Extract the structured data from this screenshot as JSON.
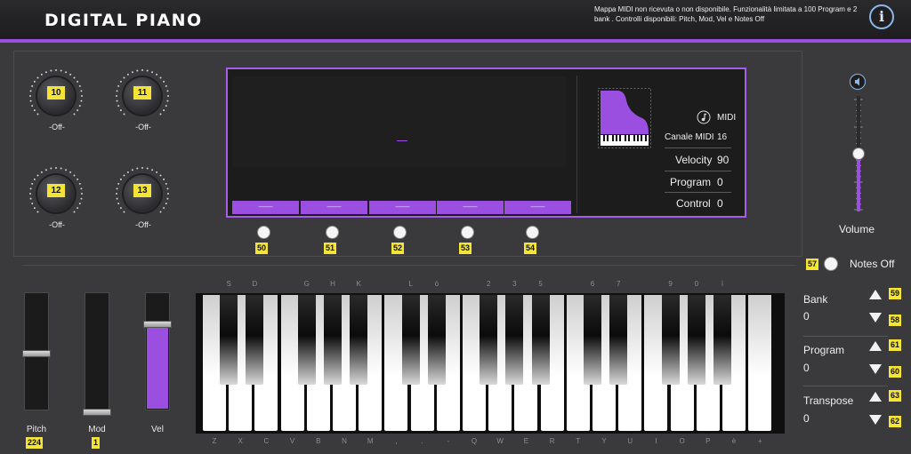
{
  "header": {
    "title": "DIGITAL PIANO",
    "notice": "Mappa MIDI non ricevuta  o non disponibile. Funzionalità limitata a 100 Program e 2 bank . Controlli disponibili: Pitch, Mod, Vel e Notes Off",
    "info_label": "i"
  },
  "knobs": [
    {
      "cc": "10",
      "label": "-Off-"
    },
    {
      "cc": "11",
      "label": "-Off-"
    },
    {
      "cc": "12",
      "label": "-Off-"
    },
    {
      "cc": "13",
      "label": "-Off-"
    }
  ],
  "display": {
    "center_text": "—",
    "presets": [
      "——",
      "——",
      "——",
      "——",
      "——"
    ],
    "preset_buttons": [
      "50",
      "51",
      "52",
      "53",
      "54"
    ],
    "midi_label": "MIDI",
    "channel_label": "Canale MIDI",
    "channel_value": "16",
    "velocity_label": "Velocity",
    "velocity_value": "90",
    "program_label": "Program",
    "program_value": "0",
    "control_label": "Control",
    "control_value": "0"
  },
  "volume": {
    "label": "Volume",
    "level_percent": 50
  },
  "notes_off": {
    "label": "Notes Off",
    "cc": "57"
  },
  "sliders": [
    {
      "label": "Pitch",
      "value": "224"
    },
    {
      "label": "Mod",
      "value": "1"
    },
    {
      "label": "Vel",
      "value": ""
    }
  ],
  "keyboard": {
    "top_labels": [
      "S",
      "D",
      "G",
      "H",
      "K",
      "L",
      "ò",
      "2",
      "3",
      "5",
      "6",
      "7",
      "9",
      "0",
      "ì"
    ],
    "bottom_labels": [
      "Z",
      "X",
      "C",
      "V",
      "B",
      "N",
      "M",
      ",",
      ".",
      "-",
      "Q",
      "W",
      "E",
      "R",
      "T",
      "Y",
      "U",
      "I",
      "O",
      "P",
      "è",
      "+"
    ]
  },
  "right_panel": {
    "bank": {
      "label": "Bank",
      "value": "0",
      "up_cc": "59",
      "down_cc": "58"
    },
    "program": {
      "label": "Program",
      "value": "0",
      "up_cc": "61",
      "down_cc": "60"
    },
    "transpose": {
      "label": "Transpose",
      "value": "0",
      "up_cc": "63",
      "down_cc": "62"
    }
  },
  "colors": {
    "accent": "#9b4fe0",
    "badge": "#f4e436",
    "background": "#3a3a3c"
  }
}
